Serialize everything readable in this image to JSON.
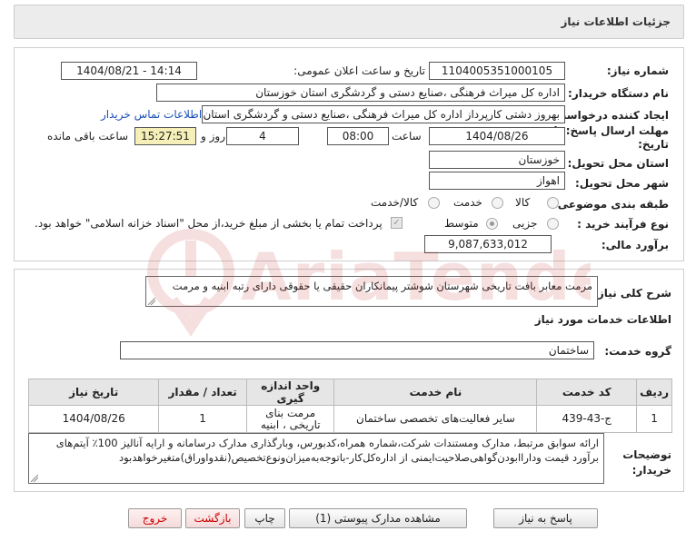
{
  "header": {
    "title": "جزئیات اطلاعات نیاز"
  },
  "fields": {
    "need_number_label": "شماره نیاز:",
    "need_number": "1104005351000105",
    "announce_label": "تاریخ و ساعت اعلان عمومی:",
    "announce_value": "1404/08/21 - 14:14",
    "buyer_org_label": "نام دستگاه خریدار:",
    "buyer_org": "اداره کل میراث فرهنگی ،صنایع دستی و گردشگری استان خوزستان",
    "creator_label": "ایجاد کننده درخواست:",
    "creator": "بهروز دشتی کارپرداز اداره کل میراث فرهنگی ،صنایع دستی و گردشگری استان خوزستان",
    "contact_link": "اطلاعات تماس خریدار",
    "deadline_label_1": "مهلت ارسال پاسخ: تا",
    "deadline_label_2": "تاریخ:",
    "deadline_date": "1404/08/26",
    "time_label": "ساعت",
    "deadline_time": "08:00",
    "days_value": "4",
    "days_label": "روز و",
    "remaining_time": "15:27:51",
    "remaining_label": "ساعت باقی مانده",
    "province_label": "استان محل تحویل:",
    "province": "خوزستان",
    "city_label": "شهر محل تحویل:",
    "city": "اهواز",
    "category_label": "طبقه بندی موضوعی:",
    "category_options": [
      "کالا",
      "خدمت",
      "کالا/خدمت"
    ],
    "process_label": "نوع فرآیند خرید :",
    "process_options": [
      "جزیی",
      "متوسط"
    ],
    "payment_note": "پرداخت تمام یا بخشی از مبلغ خرید،از محل \"اسناد خزانه اسلامی\" خواهد بود.",
    "estimate_label": "برآورد مالی:",
    "estimate_value": "9,087,633,012"
  },
  "summary": {
    "label": "شرح کلی نیاز:",
    "text": "مرمت معابر بافت تاریخی شهرستان شوشتر پیمانکاران حقیقی یا حقوقی دارای رتبه ابنیه و مرمت"
  },
  "services": {
    "section_title": "اطلاعات خدمات مورد نیاز",
    "group_label": "گروه خدمت:",
    "group_value": "ساختمان",
    "columns": [
      "ردیف",
      "کد خدمت",
      "نام خدمت",
      "واحد اندازه گیری",
      "تعداد / مقدار",
      "تاریخ نیاز"
    ],
    "rows": [
      [
        "1",
        "ج-43-439",
        "سایر فعالیت‌های تخصصی ساختمان",
        "مرمت بنای تاریخی ، ابنیه",
        "1",
        "1404/08/26"
      ]
    ]
  },
  "buyer_notes": {
    "label_1": "توضیحات",
    "label_2": "خریدار:",
    "text": "ارائه سوابق مرتبط، مدارک ومستندات شرکت،شماره همراه،کدبورس، وبارگذاری مدارک درسامانه و ارایه آنالیز 100٪ آیتم‌های برآورد قیمت وداراابودن‌گواهی‌صلاحیت‌ایمنی از اداره‌کل‌کار-باتوجه‌به‌میزان‌ونوع‌تخصیص(نقدواوراق)متغیرخواهدبود"
  },
  "buttons": {
    "reply": "پاسخ به نیاز",
    "attachments": "مشاهده مدارک پیوستی (1)",
    "print": "چاپ",
    "back": "بازگشت",
    "exit": "خروج"
  },
  "watermark": {
    "text": "AriaTender.net"
  },
  "colors": {
    "link": "#1a4fb8",
    "yellow_box": "#f6f0b8",
    "header_bg": "#ececec",
    "exit_text": "#cc0000"
  }
}
